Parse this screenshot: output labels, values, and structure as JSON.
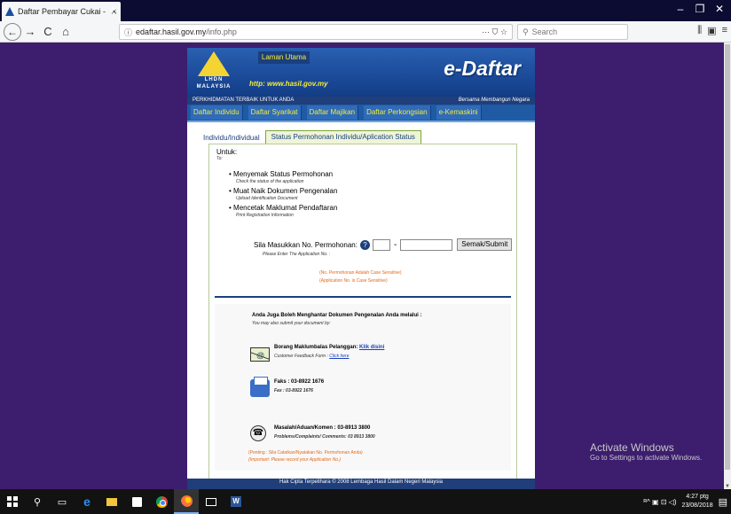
{
  "browser": {
    "tab_title": "Daftar Pembayar Cukai - Lembaga",
    "tab_close": "×",
    "new_tab": "+",
    "url_host": "edaftar.hasil.gov.my",
    "url_path": "/info.php",
    "url_prefix": "",
    "search_placeholder": "Search",
    "url_actions": "··· ⛉ ☆",
    "win_min": "–",
    "win_max": "❐",
    "win_close": "✕",
    "nav_back": "←",
    "nav_forward": "→",
    "nav_reload": "C",
    "nav_home": "⌂",
    "tools_library": "⫼",
    "tools_sidebar": "▣",
    "tools_menu": "≡"
  },
  "site": {
    "logo_text": "LHDN MALAYSIA",
    "home_link": "Laman Utama",
    "url_text": "http: www.hasil.gov.my",
    "brand": "e-Daftar",
    "tagline_left": "PERKHIDMATAN TERBAIK UNTUK ANDA",
    "tagline_right": "Bersama Membangun Negara",
    "menu": [
      {
        "label": "Daftar Individu"
      },
      {
        "label": "Daftar Syarikat"
      },
      {
        "label": "Daftar Majikan"
      },
      {
        "label": "Daftar Perkongsian"
      },
      {
        "label": "e-Kemaskini"
      }
    ],
    "tabs": [
      {
        "label": "Individu/Individual"
      },
      {
        "label": "Status Permohonan Individu/Aplication Status"
      }
    ]
  },
  "content": {
    "untuk": "Untuk:",
    "to": "To:",
    "bullets": [
      {
        "ms": "Menyemak Status Permohonan",
        "en": "Check the status of the application"
      },
      {
        "ms": "Muat Naik Dokumen Pengenalan",
        "en": "Upload Identification Document"
      },
      {
        "ms": "Mencetak Maklumat Pendaftaran",
        "en": "Print Registration Information"
      }
    ],
    "form_label": "Sila Masukkan No. Permohonan:",
    "help_icon": "?",
    "dash": "-",
    "input1_value": "",
    "input2_value": "",
    "submit_label": "Semak/Submit",
    "form_hint": "Please Enter The Application No. :",
    "note_ms": "(No. Permohonan Adalah Case Sensitive)",
    "note_en": "(Application No. is Case Sensitive)",
    "alt_ms": "Anda Juga Boleh Menghantar Dokumen Pengenalan Anda melalui :",
    "alt_en": "You may also submit your document by:",
    "feedback_ms": "Borang Maklumbalas Pelanggan:",
    "feedback_link": "Klik disini",
    "feedback_en": "Customer Feedback Form :",
    "feedback_en_link": "Click here",
    "fax_ms": "Faks : 03-8922 1676",
    "fax_en": "Fax : 03-8922 1676",
    "phone_ms": "Masalah/Aduan/Komen : 03-8913 3800",
    "phone_en": "Problems/Complaints/ Comments: 03 8913 3800",
    "important_ms": "(Penting : Sila Catatkan/Nyatakan No. Permohonan Anda)",
    "important_en": "(Important: Please record your Application No.)",
    "footer": "Hak Cipta Terpelihara © 2008 Lembaga Hasil Dalam Negeri Malaysia"
  },
  "watermark": {
    "line1": "Activate Windows",
    "line2": "Go to Settings to activate Windows."
  },
  "taskbar": {
    "word_letter": "W",
    "ie_letter": "e",
    "search_icon": "⚲",
    "taskview_icon": "▭",
    "tray_icons": "ᴿ^ ▣ ⊡ ◁)",
    "time": "4:27 ptg",
    "date": "23/08/2018",
    "notify_icon": "▤"
  }
}
